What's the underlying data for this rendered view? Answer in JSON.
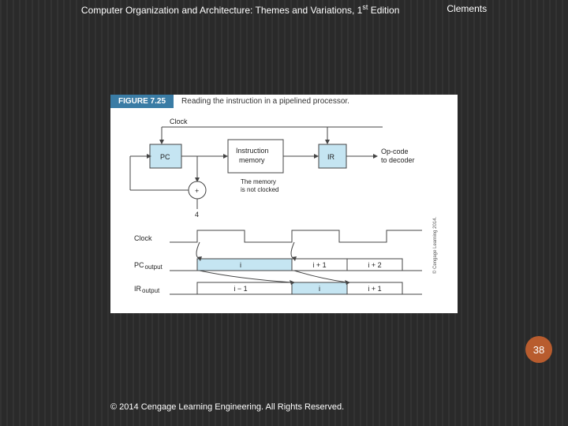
{
  "header": {
    "title_prefix": "Computer Organization and Architecture: Themes and Variations, 1",
    "title_sup": "st",
    "title_suffix": " Edition",
    "author": "Clements"
  },
  "figure": {
    "number": "FIGURE 7.25",
    "caption": "Reading the instruction in a pipelined processor."
  },
  "diagram": {
    "clock_top": "Clock",
    "pc": "PC",
    "imem_l1": "Instruction",
    "imem_l2": "memory",
    "ir": "IR",
    "opcode_l1": "Op-code",
    "opcode_l2": "to decoder",
    "note_l1": "The memory",
    "note_l2": "is not clocked",
    "four": "4",
    "plus": "+",
    "clock_wave": "Clock",
    "pc_out": "PC",
    "pc_out_sub": "output",
    "ir_out": "IR",
    "ir_out_sub": "output",
    "pc_vals": [
      "i",
      "i + 1",
      "i + 2"
    ],
    "ir_vals": [
      "i − 1",
      "i",
      "i + 1"
    ],
    "credit": "© Cengage Learning 2014."
  },
  "page_number": "38",
  "footer": "© 2014 Cengage Learning Engineering. All Rights Reserved."
}
